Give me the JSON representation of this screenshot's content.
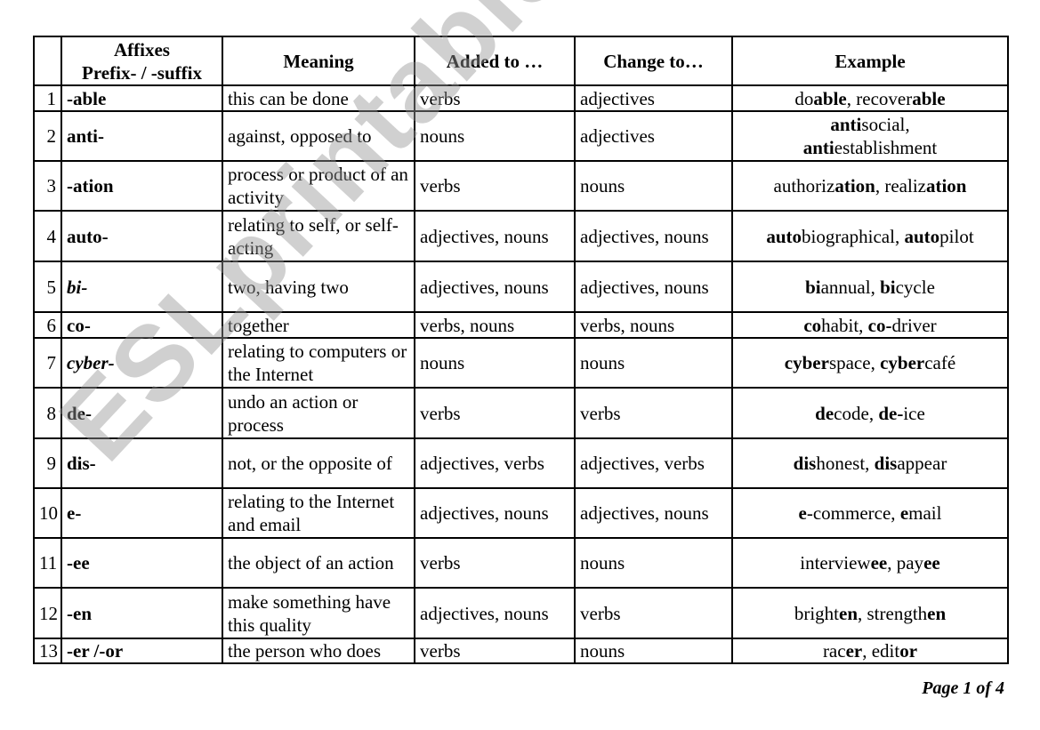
{
  "table": {
    "headers": {
      "num": "",
      "affix_line1": "Affixes",
      "affix_line2": "Prefix- / -suffix",
      "meaning": "Meaning",
      "added_to": "Added to …",
      "change_to": "Change to…",
      "example": "Example"
    },
    "rows": [
      {
        "num": "1",
        "affix": "-able",
        "italic": false,
        "meaning": "this can be done",
        "added_to": "verbs",
        "change_to": "adjectives",
        "example": [
          [
            "do",
            false
          ],
          [
            "able",
            true
          ],
          [
            ", recover",
            false
          ],
          [
            "able",
            true
          ]
        ],
        "h": 29
      },
      {
        "num": "2",
        "affix": "anti-",
        "italic": false,
        "meaning": "against, opposed to",
        "added_to": "nouns",
        "change_to": "adjectives",
        "example": [
          [
            "anti",
            true
          ],
          [
            "social,\n",
            false
          ],
          [
            "anti",
            true
          ],
          [
            "establishment",
            false
          ]
        ],
        "h": 56
      },
      {
        "num": "3",
        "affix": "-ation",
        "italic": false,
        "meaning": "process or product of an activity",
        "added_to": "verbs",
        "change_to": "nouns",
        "example": [
          [
            "authoriz",
            false
          ],
          [
            "ation",
            true
          ],
          [
            ", realiz",
            false
          ],
          [
            "ation",
            true
          ]
        ],
        "h": 56
      },
      {
        "num": "4",
        "affix": "auto-",
        "italic": false,
        "meaning": "relating to self, or self-acting",
        "added_to": "adjectives, nouns",
        "change_to": "adjectives, nouns",
        "example": [
          [
            "auto",
            true
          ],
          [
            "biographical, ",
            false
          ],
          [
            "auto",
            true
          ],
          [
            "pilot",
            false
          ]
        ],
        "h": 57
      },
      {
        "num": "5",
        "affix": "bi-",
        "italic": true,
        "meaning": "two, having two",
        "added_to": "adjectives, nouns",
        "change_to": "adjectives, nouns",
        "example": [
          [
            "bi",
            true
          ],
          [
            "annual, ",
            false
          ],
          [
            "bi",
            true
          ],
          [
            "cycle",
            false
          ]
        ],
        "h": 57
      },
      {
        "num": "6",
        "affix": "co-",
        "italic": false,
        "meaning": "together",
        "added_to": "verbs, nouns",
        "change_to": "verbs, nouns",
        "example": [
          [
            "co",
            true
          ],
          [
            "habit, ",
            false
          ],
          [
            "co-",
            true
          ],
          [
            "driver",
            false
          ]
        ],
        "h": 29
      },
      {
        "num": "7",
        "affix": "cyber-",
        "italic": true,
        "meaning": "relating to computers or the Internet",
        "added_to": "nouns",
        "change_to": "nouns",
        "example": [
          [
            "cyber",
            true
          ],
          [
            "space, ",
            false
          ],
          [
            "cyber",
            true
          ],
          [
            "café",
            false
          ]
        ],
        "h": 56
      },
      {
        "num": "8",
        "affix": "de-",
        "italic": false,
        "meaning": "undo an action or process",
        "added_to": "verbs",
        "change_to": "verbs",
        "example": [
          [
            "de",
            true
          ],
          [
            "code, ",
            false
          ],
          [
            "de-",
            true
          ],
          [
            "ice",
            false
          ]
        ],
        "h": 57
      },
      {
        "num": "9",
        "affix": "dis-",
        "italic": false,
        "meaning": "not, or the opposite of",
        "added_to": "adjectives, verbs",
        "change_to": "adjectives, verbs",
        "example": [
          [
            "dis",
            true
          ],
          [
            "honest, ",
            false
          ],
          [
            "dis",
            true
          ],
          [
            "appear",
            false
          ]
        ],
        "h": 56
      },
      {
        "num": "10",
        "affix": "e-",
        "italic": false,
        "meaning": "relating to the Internet and email",
        "added_to": "adjectives, nouns",
        "change_to": "adjectives, nouns",
        "example": [
          [
            "e",
            true
          ],
          [
            "-commerce, ",
            false
          ],
          [
            "e",
            true
          ],
          [
            "mail",
            false
          ]
        ],
        "h": 56
      },
      {
        "num": "11",
        "affix": "-ee",
        "italic": false,
        "meaning": "the object of an action",
        "added_to": "verbs",
        "change_to": "nouns",
        "example": [
          [
            "interview",
            false
          ],
          [
            "ee",
            true
          ],
          [
            ", pay",
            false
          ],
          [
            "ee",
            true
          ]
        ],
        "h": 56
      },
      {
        "num": "12",
        "affix": "-en",
        "italic": false,
        "meaning": "make something have this quality",
        "added_to": "adjectives, nouns",
        "change_to": "verbs",
        "example": [
          [
            "bright",
            false
          ],
          [
            "en",
            true
          ],
          [
            ", strength",
            false
          ],
          [
            "en",
            true
          ]
        ],
        "h": 57
      },
      {
        "num": "13",
        "affix": "-er /-or",
        "italic": false,
        "meaning": "the person who does",
        "added_to": "verbs",
        "change_to": "nouns",
        "example": [
          [
            "rac",
            false
          ],
          [
            "er",
            true
          ],
          [
            ", edit",
            false
          ],
          [
            "or",
            true
          ]
        ],
        "h": 28
      }
    ]
  },
  "footer": {
    "page_label": "Page 1 of 4"
  },
  "watermark": {
    "text": "ESLprintables.com"
  }
}
